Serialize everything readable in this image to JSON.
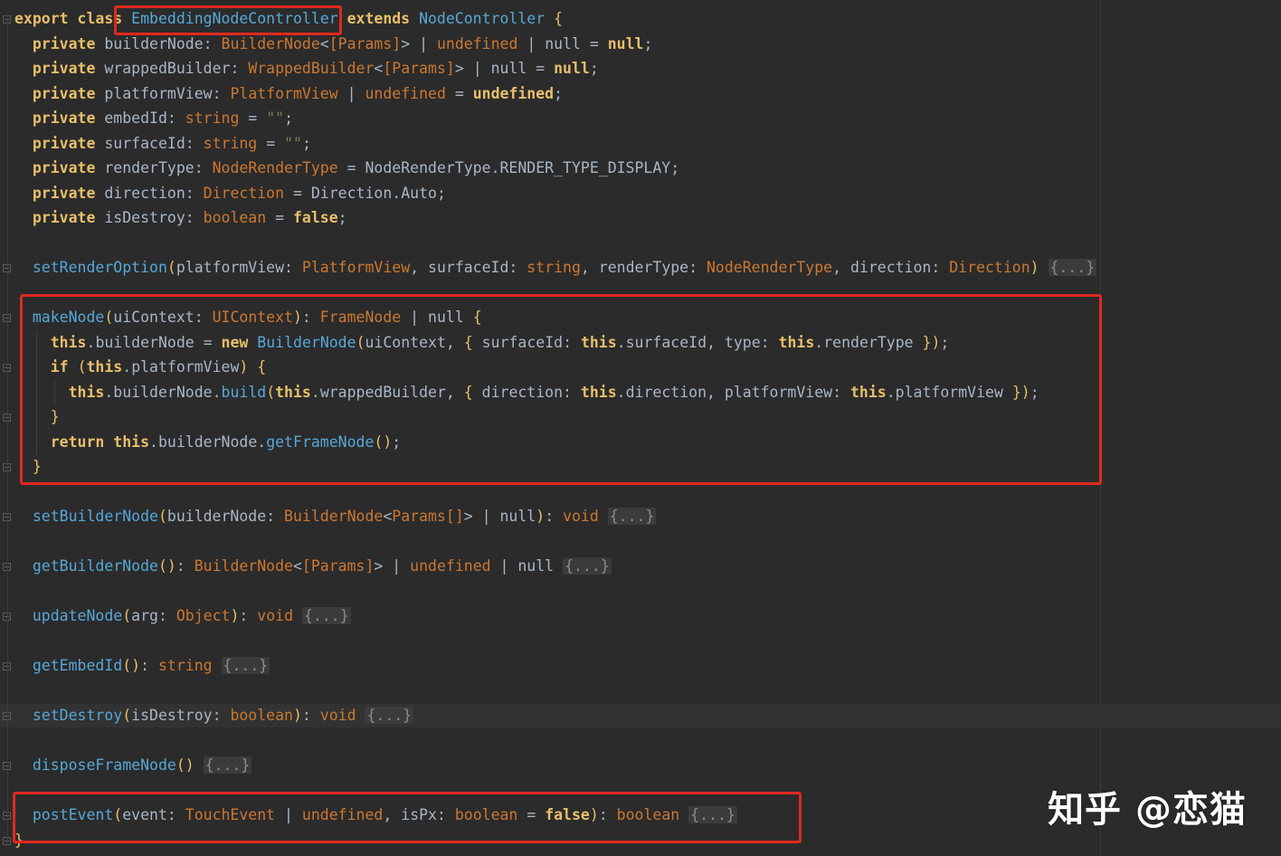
{
  "editor": {
    "language": "ArkTS",
    "colors": {
      "background": "#2b2b2b",
      "keyword": "#cc7832",
      "function": "#56a8d8",
      "string": "#6a8759",
      "generic": "#9876aa",
      "text": "#a9b7c6",
      "highlight_box": "#e0291f"
    },
    "fold_placeholder": "{...}",
    "lines": [
      "export class EmbeddingNodeController extends NodeController {",
      "  private builderNode: BuilderNode<[Params]> | undefined | null = null;",
      "  private wrappedBuilder: WrappedBuilder<[Params]> | null = null;",
      "  private platformView: PlatformView | undefined = undefined;",
      "  private embedId: string = \"\";",
      "  private surfaceId: string = \"\";",
      "  private renderType: NodeRenderType = NodeRenderType.RENDER_TYPE_DISPLAY;",
      "  private direction: Direction = Direction.Auto;",
      "  private isDestroy: boolean = false;",
      "",
      "  setRenderOption(platformView: PlatformView, surfaceId: string, renderType: NodeRenderType, direction: Direction) {...}",
      "",
      "  makeNode(uiContext: UIContext): FrameNode | null {",
      "    this.builderNode = new BuilderNode(uiContext, { surfaceId: this.surfaceId, type: this.renderType });",
      "    if (this.platformView) {",
      "      this.builderNode.build(this.wrappedBuilder, { direction: this.direction, platformView: this.platformView });",
      "    }",
      "    return this.builderNode.getFrameNode();",
      "  }",
      "",
      "  setBuilderNode(builderNode: BuilderNode<Params[]> | null): void {...}",
      "",
      "  getBuilderNode(): BuilderNode<[Params]> | undefined | null {...}",
      "",
      "  updateNode(arg: Object): void {...}",
      "",
      "  getEmbedId(): string {...}",
      "",
      "  setDestroy(isDestroy: boolean): void {...}",
      "",
      "  disposeFrameNode() {...}",
      "",
      "  postEvent(event: TouchEvent | undefined, isPx: boolean = false): boolean {...}",
      "}"
    ]
  },
  "watermark": {
    "text": "知乎 @恋猫"
  }
}
